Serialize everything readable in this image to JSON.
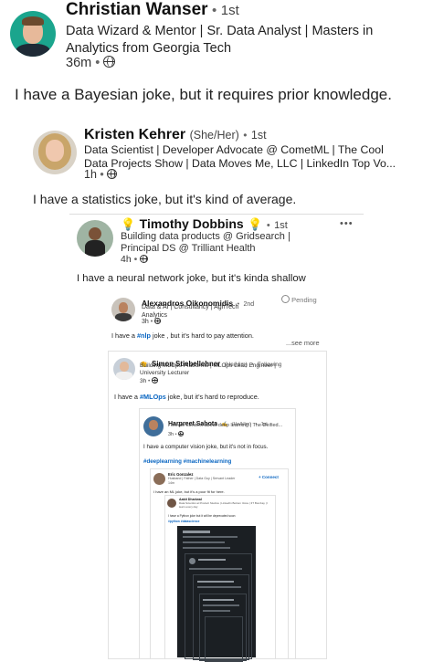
{
  "post1": {
    "name": "Christian Wanser",
    "degree": "1st",
    "headline_line1": "Data Wizard & Mentor | Sr. Data Analyst | Masters in",
    "headline_line2": "Analytics from Georgia Tech",
    "time": "36m",
    "body": "I have a Bayesian joke, but it requires prior knowledge."
  },
  "post2": {
    "name": "Kristen Kehrer",
    "pronouns": "(She/Her)",
    "degree": "1st",
    "headline_line1": "Data Scientist | Developer Advocate @ CometML | The Cool",
    "headline_line2": "Data Projects Show | Data Moves Me, LLC | LinkedIn Top Vo...",
    "time": "1h",
    "body": "I have a statistics joke, but it's kind of average."
  },
  "post3": {
    "name": "Timothy Dobbins",
    "degree": "1st",
    "more": "•••",
    "headline_line1": "Building data products @ Gridsearch |",
    "headline_line2": "Principal DS @ Trilliant Health",
    "time": "4h",
    "body": "I have a neural network joke, but it's kinda shallow"
  },
  "post4": {
    "name": "Alexandros Oikonomidis",
    "degree": "2nd",
    "pending": "Pending",
    "headline_line1": "Data & AI | Consultancy | AgriTech",
    "headline_line2": "Analytics",
    "time": "3h",
    "body_pre": "I have a ",
    "hashtag": "#nlp",
    "body_post": " joke , but it's hard to pay attention.",
    "see_more": "...see more"
  },
  "post5": {
    "name": "Simon Stiebellehner",
    "pronouns": "(He/Him)",
    "follow": "Following",
    "headline_line1": "Building MLOps Platforms | MLOps Lead Engineer |",
    "headline_line2": "University Lecturer",
    "time": "3h",
    "body_pre": "I have a ",
    "hashtag": "#MLOps",
    "body_post": " joke, but it's hard to reproduce."
  },
  "post6": {
    "name": "Harpreet Sahota",
    "pronouns": "(He/Him)",
    "degree": "1st",
    "headline": "I create content about deep learning | The Deified...",
    "time": "3h",
    "body": "I have a computer vision joke, but it's not in focus.",
    "hashtags": "#deeplearning #machinelearning"
  },
  "post7": {
    "name": "Eric Gonzalez",
    "headline": "Husband | Father | Data Guy | Servant Leader",
    "time": "14m",
    "connect": "Connect",
    "body": "I have an ML joke, but it's a poor fit for here."
  },
  "post8": {
    "name": "Aakit Dhariwal",
    "headline": "Data Scientist at Product Studios | LinkedIn Bottom Voice | IIT Bombay | I learn every day",
    "body": "I have a Python joke but it will be deprecated soon",
    "hashtags": "#python #datascience"
  }
}
